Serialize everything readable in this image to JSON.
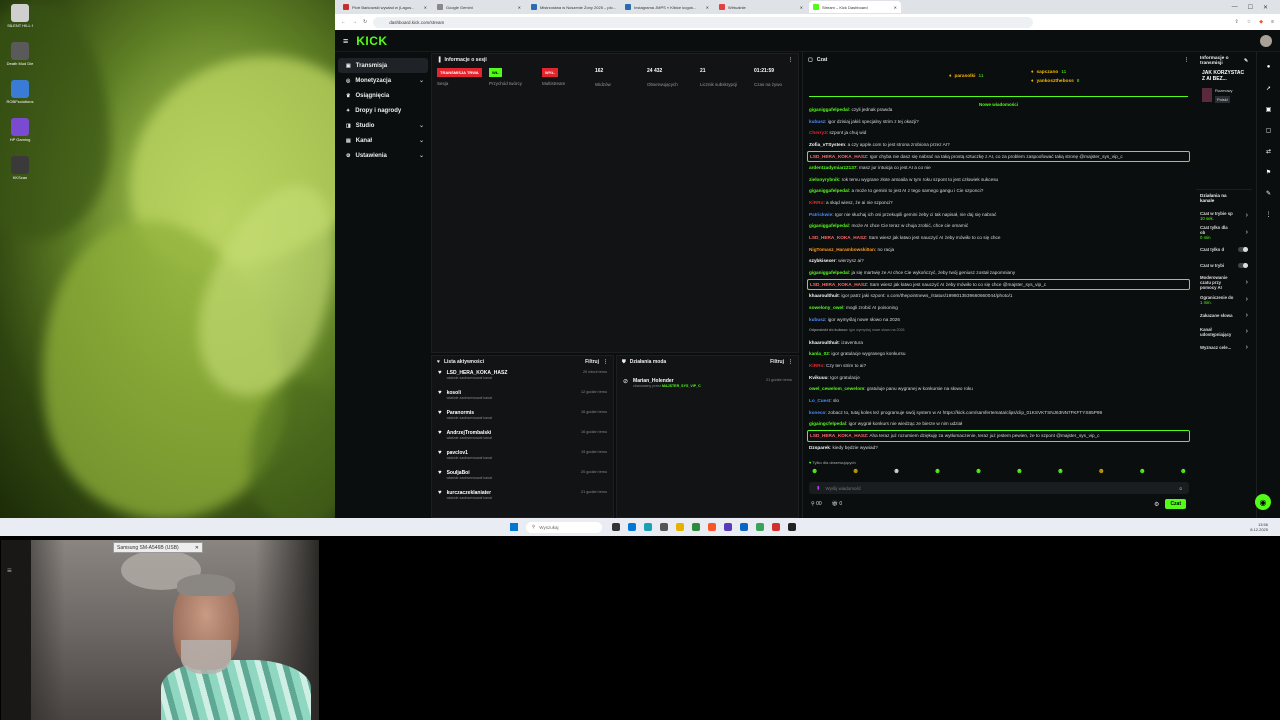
{
  "desktop": {
    "icons": [
      "SILENT HILL f",
      "Death Mud Die",
      "ROBFsolutions",
      "HP Gaming",
      "KKScan"
    ]
  },
  "browser": {
    "tabs": [
      {
        "label": "Piotr Barkowski wywiad w (Lagos...",
        "color": "#c4302b",
        "active": false
      },
      {
        "label": "Google Gemini",
        "color": "#888",
        "active": false
      },
      {
        "label": "Mistrzostwa w Noszenie Żony 2025 – plo...",
        "color": "#2b6cb0",
        "active": false
      },
      {
        "label": "Instagrama JMPS » Kibice kogoś...",
        "color": "#2b6cb0",
        "active": false
      },
      {
        "label": "Wirtualnie",
        "color": "#e53e3e",
        "active": false
      },
      {
        "label": "Stream – Kick Dashboard",
        "color": "#53fc18",
        "active": true
      }
    ],
    "url": "dashboard.kick.com/stream"
  },
  "kick": {
    "logo": "KICK",
    "sidebar": [
      {
        "label": "Transmisja",
        "icon": "broadcast-icon",
        "active": true,
        "chev": false
      },
      {
        "label": "Monetyzacja",
        "icon": "coin-icon",
        "active": false,
        "chev": true
      },
      {
        "label": "Osiągnięcia",
        "icon": "trophy-icon",
        "active": false,
        "chev": false
      },
      {
        "label": "Dropy i nagrody",
        "icon": "gift-icon",
        "active": false,
        "chev": false
      },
      {
        "label": "Studio",
        "icon": "studio-icon",
        "active": false,
        "chev": true
      },
      {
        "label": "Kanał",
        "icon": "channel-icon",
        "active": false,
        "chev": true
      },
      {
        "label": "Ustawienia",
        "icon": "gear-icon",
        "active": false,
        "chev": true
      }
    ],
    "session": {
      "title": "Informacje o sesji",
      "stats": [
        {
          "badge": "TRANSMISJA TRWA",
          "badge_color": "#e3262e",
          "label": "Sesja"
        },
        {
          "badge": "WŁ.",
          "badge_color": "#53fc18",
          "label": "Przychód twórcy"
        },
        {
          "badge": "WYŁ.",
          "badge_color": "#e3262e",
          "label": "Multistream"
        },
        {
          "value": "162",
          "label": "Widzów"
        },
        {
          "value": "24 432",
          "label": "Obserwujących"
        },
        {
          "value": "21",
          "label": "Licznik subskrypcji"
        },
        {
          "value": "01:21:59",
          "label": "Czas na żywo"
        }
      ]
    },
    "activity": {
      "title": "Lista aktywności",
      "filter": "Filtruj",
      "items": [
        {
          "name": "LSD_HERA_KOKA_HASZ",
          "sub": "właśnie zaobserwował kanał",
          "time": "20 minut temu"
        },
        {
          "name": "kosoli",
          "sub": "właśnie zaobserwował kanał",
          "time": "12 godzin temu"
        },
        {
          "name": "Paranormis",
          "sub": "właśnie zaobserwował kanał",
          "time": "16 godzin temu"
        },
        {
          "name": "AndrzejTrombalski",
          "sub": "właśnie zaobserwował kanał",
          "time": "16 godzin temu"
        },
        {
          "name": "pavclov1",
          "sub": "właśnie zaobserwował kanał",
          "time": "19 godzin temu"
        },
        {
          "name": "SouljaBoi",
          "sub": "właśnie zaobserwował kanał",
          "time": "20 godzin temu"
        },
        {
          "name": "kurczaczeklaniater",
          "sub": "właśnie zaobserwował kanał",
          "time": "21 godzin temu"
        }
      ]
    },
    "modactions": {
      "title": "Działania moda",
      "filter": "Filtruj",
      "item": {
        "name": "Marian_Holender",
        "by": "zbanowany przez",
        "mod": "MAJSTER_SYS_VIP_C",
        "time": "21 godzin temu"
      }
    },
    "chat": {
      "title": "Czat",
      "top": [
        {
          "name": "parasolki",
          "sub": "11"
        },
        {
          "name": "sapczano",
          "sub": "11"
        },
        {
          "name": "yankosztheboss",
          "sub": "8"
        }
      ],
      "new_messages": "Nowe wiadomości",
      "messages": [
        {
          "u": "giganiggafelpedal",
          "c": "#53fc18",
          "t": "czyli jednak prawda"
        },
        {
          "u": "kubusz",
          "c": "#4b8bff",
          "t": "igor dzisiaj jakiś specjalny strim z tej okazji?"
        },
        {
          "u": "Cherry3",
          "c": "#e3262e",
          "t": "szpont ja chuj wid"
        },
        {
          "u": "Zofia_vTSystem",
          "c": "#f5f5f5",
          "t": "a czy apple.com to jest strona zrobiona przez AI?"
        },
        {
          "u": "LSD_HERA_KOKA_HASZ",
          "c": "#ff6a6a",
          "t": "Igor chyba nie dasz się nabrać na taką prostą sztuczkę z AI, co za problem zaspoofować taką stronę @majster_sys_vip_c",
          "hl": true
        },
        {
          "u": "ardentzadymiarz2137",
          "c": "#53fc18",
          "t": "masz jur intuicja co jest AI a co nie"
        },
        {
          "u": "zielonyrybnik",
          "c": "#53fc18",
          "t": "rok temu wygrane złote antoaila w tym roku szpont to jest człowiek sukcesu"
        },
        {
          "u": "giganiggafelpedal",
          "c": "#53fc18",
          "t": "a może to gemini to jest AI z tego samego gangu i Cie szponci?"
        },
        {
          "u": "KiRRo",
          "c": "#e3262e",
          "t": "a skąd wiesz, że ai nie szponci?"
        },
        {
          "u": "Patrickwie",
          "c": "#4b8bff",
          "t": "Igor nie słuchaj ich oni przekupili gemini żeby ci tak napisał, nie daj się nabrać"
        },
        {
          "u": "giganiggafelpedal",
          "c": "#53fc18",
          "t": "może AI chce Cie teraz w chuja zrobić, chce cie omamić"
        },
        {
          "u": "LSD_HERA_KOKA_HASZ",
          "c": "#ff6a6a",
          "t": "Sam wiesz jak łatwo jest nauczyć AI żeby mówiło to co się chce"
        },
        {
          "u": "NigTomasz_Harambowski0an",
          "c": "#ff9a1a",
          "t": "no racja"
        },
        {
          "u": "szybkisexer",
          "c": "#f5f5f5",
          "t": "wierzysz ai?"
        },
        {
          "u": "giganiggafelpedal",
          "c": "#53fc18",
          "t": "ja się martwię ze AI chce Cie wykończyć, żeby twój geniusz został zapomniany"
        },
        {
          "u": "LSD_HERA_KOKA_HASZ",
          "c": "#ff6a6a",
          "t": "Sam wiesz jak łatwo jest nauczyć AI żeby mówiło to co się chce @majster_sys_vip_c",
          "hl": true
        },
        {
          "u": "khaaroulthuit",
          "c": "#f5f5f5",
          "t": "igor patrz jaki szpont: x.com/thepointnews_/status/1998013539660660044/photo/1"
        },
        {
          "u": "sowelony_owel",
          "c": "#53fc18",
          "t": "mogli zrobić AI poisoning"
        },
        {
          "u": "kubusz",
          "c": "#4b8bff",
          "t": "igor wymyślaj nowe słowo na 2026"
        },
        {
          "u": "Odpowiedź do kubusz:",
          "c": "#888",
          "t": "igor wymyślaj nowe słowo na 2026",
          "sm": true
        },
        {
          "u": "khaaroulthuit",
          "c": "#f5f5f5",
          "t": "izaventura"
        },
        {
          "u": "kanla_02",
          "c": "#53fc18",
          "t": "igor gratulacje wygranego konkursu"
        },
        {
          "u": "KiRRo",
          "c": "#e3262e",
          "t": "Czy ten strim to ai?"
        },
        {
          "u": "Kvikuuu",
          "c": "#f5f5f5",
          "t": "Igor gratulacje"
        },
        {
          "u": "owel_cewelom_cewelom",
          "c": "#53fc18",
          "t": "gratuluje panu wygranej w konkursie na słowo roku"
        },
        {
          "u": "Lo_Cuest",
          "c": "#4b8bff",
          "t": "slo"
        },
        {
          "u": "koneco",
          "c": "#4b8bff",
          "t": "zobacz to, tutaj koles też programuje swój system w AI https://kick.com/samfertemata/clips/clip_01KSVKTSNJ63NN7FKFTYS85P99"
        },
        {
          "u": "gigaingcfelpedal",
          "c": "#53fc18",
          "t": "igor wygrał konkurs nie wiedząc ze bierze w nim udział"
        },
        {
          "u": "LSD_HERA_KOKA_HASZ",
          "c": "#ff6a6a",
          "t": "Aha teraz już rozumiem dziękuję za wytłumaczenie, teraz już jestem pewien, że to szpont @majster_sys_vip_c",
          "hl": true
        },
        {
          "u": "Dzsparek",
          "c": "#f5f5f5",
          "t": "kiedy będzie wywiad?"
        }
      ],
      "mode": "Tylko dla obserwujących",
      "input_placeholder": "Wyślij wiadomość",
      "counter1": "00",
      "counter2": "0",
      "send": "Czat"
    },
    "right": {
      "title": "Informacje o transmisji",
      "stream_title": "JAK KORZYSTAĆ Z AI BEZ...",
      "category": "Rozmowy",
      "lang": "Polski",
      "actions_title": "Działania na kanale",
      "actions": [
        {
          "label": "Czat w trybie sp",
          "value": "10 sek."
        },
        {
          "label": "Czat tylko dla ob",
          "value": "0 min"
        },
        {
          "label": "Czat tylko d",
          "toggle": true
        },
        {
          "label": "Czat w trybi",
          "toggle": true
        },
        {
          "label": "Moderowanie czatu przy pomocy AI",
          "value": ""
        },
        {
          "label": "Ograniczenie do",
          "value": "1 min."
        },
        {
          "label": "Zakazane słowa",
          "value": ""
        },
        {
          "label": "Kanał udostępniający",
          "value": ""
        },
        {
          "label": "Wyznacz cele...",
          "value": ""
        }
      ]
    }
  },
  "taskbar": {
    "search_placeholder": "Wyszukaj",
    "time": "13:56",
    "date": "8.12.2025"
  },
  "webcam": {
    "device_label": "Samsung SM-A546B (USB)"
  }
}
